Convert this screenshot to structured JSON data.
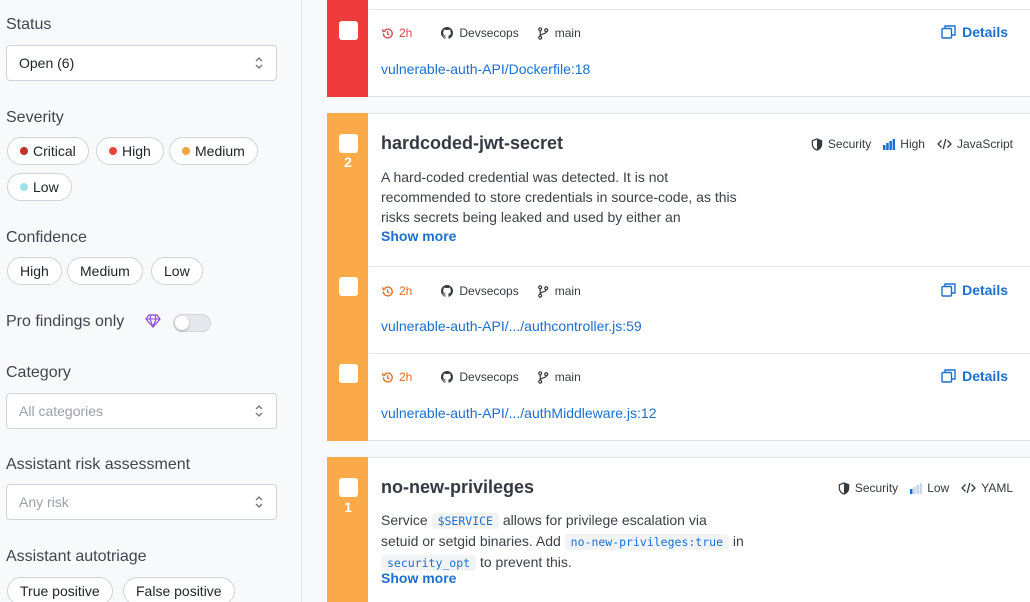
{
  "sidebar": {
    "status": {
      "title": "Status",
      "value": "Open (6)"
    },
    "severity": {
      "title": "Severity",
      "options": [
        {
          "label": "Critical",
          "color": "#c4302b"
        },
        {
          "label": "High",
          "color": "#e8453c"
        },
        {
          "label": "Medium",
          "color": "#f0a440"
        },
        {
          "label": "Low",
          "color": "#9ee2e6"
        }
      ]
    },
    "confidence": {
      "title": "Confidence",
      "options": [
        "High",
        "Medium",
        "Low"
      ]
    },
    "pro_findings": {
      "title": "Pro findings only",
      "enabled": false
    },
    "category": {
      "title": "Category",
      "placeholder": "All categories"
    },
    "risk": {
      "title": "Assistant risk assessment",
      "placeholder": "Any risk"
    },
    "autotriage": {
      "title": "Assistant autotriage",
      "options": [
        "True positive",
        "False positive"
      ]
    }
  },
  "colors": {
    "critical": "#ef3b3b",
    "medium": "#fbaa4a",
    "link": "#1c6fd1"
  },
  "cards": [
    {
      "severity": "critical",
      "findings": [
        {
          "age": "2h",
          "repo": "Devsecops",
          "branch": "main",
          "details_label": "Details",
          "path": "vulnerable-auth-API/Dockerfile:18"
        }
      ]
    },
    {
      "severity": "medium",
      "count": "2",
      "rule": "hardcoded-jwt-secret",
      "category": "Security",
      "confidence": "High",
      "language": "JavaScript",
      "description": "A hard-coded credential was detected. It is not recommended to store credentials in source-code, as this risks secrets being leaked and used by either an",
      "show_more": "Show more",
      "findings": [
        {
          "age": "2h",
          "repo": "Devsecops",
          "branch": "main",
          "details_label": "Details",
          "path": "vulnerable-auth-API/.../authcontroller.js:59"
        },
        {
          "age": "2h",
          "repo": "Devsecops",
          "branch": "main",
          "details_label": "Details",
          "path": "vulnerable-auth-API/.../authMiddleware.js:12"
        }
      ]
    },
    {
      "severity": "medium",
      "count": "1",
      "rule": "no-new-privileges",
      "category": "Security",
      "confidence": "Low",
      "language": "YAML",
      "description_parts": {
        "t1": "Service",
        "code1": "$SERVICE",
        "t2": "allows for privilege escalation via setuid or setgid binaries. Add",
        "code2": "no-new-privileges:true",
        "t3": "in",
        "code3": "security_opt",
        "t4": "to prevent this."
      },
      "show_more": "Show more"
    }
  ]
}
